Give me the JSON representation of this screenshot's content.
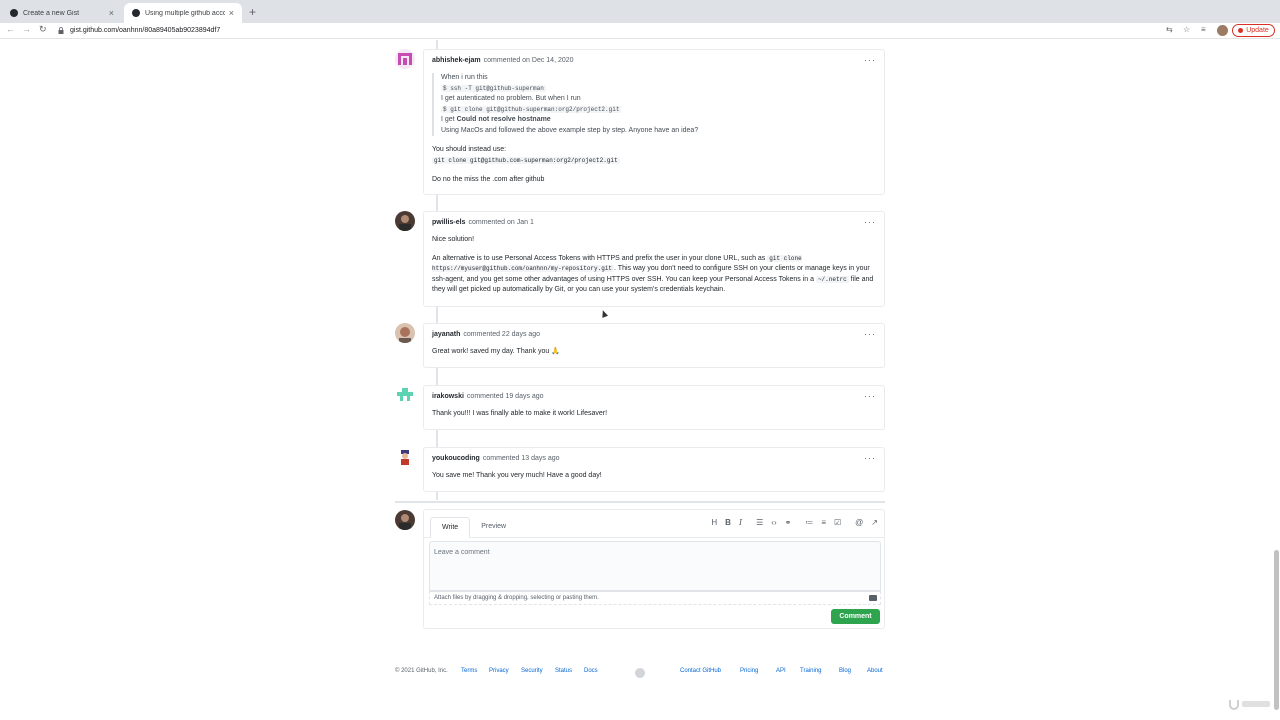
{
  "browser": {
    "tabs": [
      {
        "label": "Create a new Gist"
      },
      {
        "label": "Using multiple github accounts"
      }
    ],
    "url": "gist.github.com/oanhnn/80a89405ab9023894df7",
    "update_label": "Update"
  },
  "comments": [
    {
      "author": "abhishek-ejam",
      "meta": "commented on Dec 14, 2020",
      "quote": {
        "line1": "When i run this",
        "code1": "$ ssh -T git@github-superman",
        "line2": "I get autenticated no problem. But when I run",
        "code2": "$ git clone git@github-superman:org2/project2.git",
        "line3_prefix": "I get ",
        "line3_strong": "Could not resolve hostname",
        "line4": "Using MacOs and followed the above example step by step. Anyone have an idea?"
      },
      "instead": "You should instead use:",
      "instead_code": "git clone git@github.com-superman:org2/project2.git",
      "tip": "Do no the miss the .com after github"
    },
    {
      "author": "pwillis-els",
      "meta": "commented on Jan 1",
      "p1": "Nice solution!",
      "p2a": "An alternative is to use Personal Access Tokens with HTTPS and prefix the user in your clone URL, such as ",
      "p2code1": "git clone https://myuser@github.com/oanhnn/my-repository.git",
      "p2b": ". This way you don't need to configure SSH on your clients or manage keys in your ssh-agent, and you get some other advantages of using HTTPS over SSH. You can keep your Personal Access Tokens in a ",
      "p2code2": "~/.netrc",
      "p2c": " file and they will get picked up automatically by Git, or you can use your system's credentials keychain."
    },
    {
      "author": "jayanath",
      "meta": "commented 22 days ago",
      "body": "Great work! saved my day. Thank you 🙏"
    },
    {
      "author": "irakowski",
      "meta": "commented 19 days ago",
      "body": "Thank you!!! I was finally able to make it work! Lifesaver!"
    },
    {
      "author": "youkoucoding",
      "meta": "commented 13 days ago",
      "body": "You save me! Thank you very much! Have a good day!"
    }
  ],
  "editor": {
    "tab_write": "Write",
    "tab_preview": "Preview",
    "placeholder": "Leave a comment",
    "attach_hint": "Attach files by dragging & dropping, selecting or pasting them.",
    "submit_label": "Comment",
    "toolbar_icons": [
      "heading-icon",
      "bold-icon",
      "italic-icon",
      "quote-icon",
      "code-icon",
      "link-icon",
      "unordered-list-icon",
      "ordered-list-icon",
      "task-list-icon",
      "mention-icon",
      "reference-icon"
    ]
  },
  "footer": {
    "copyright": "© 2021 GitHub, Inc.",
    "left_links": [
      "Terms",
      "Privacy",
      "Security",
      "Status",
      "Docs"
    ],
    "right_links": [
      "Contact GitHub",
      "Pricing",
      "API",
      "Training",
      "Blog",
      "About"
    ]
  },
  "colors": {
    "accent_green": "#2ea44f",
    "link_blue": "#0366d6",
    "update_red": "#d93025"
  }
}
